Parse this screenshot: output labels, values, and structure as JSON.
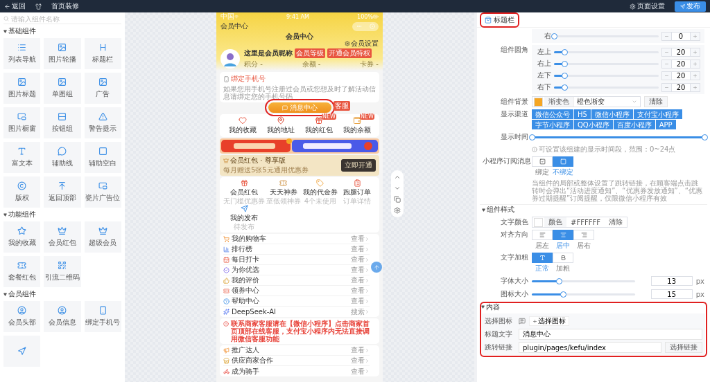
{
  "top_bar": {
    "back": "返回",
    "page_title": "首页装修",
    "page_settings": "页面设置",
    "publish": "发布"
  },
  "left_panel": {
    "search_placeholder": "请输入组件名称",
    "groups": [
      {
        "title": "基础组件",
        "expanded": true,
        "items": [
          {
            "label": "列表导航"
          },
          {
            "label": "图片轮播"
          },
          {
            "label": "标题栏"
          },
          {
            "label": "图片标题"
          },
          {
            "label": "单图组"
          },
          {
            "label": "广告"
          },
          {
            "label": "图片橱窗"
          },
          {
            "label": "按钮组"
          },
          {
            "label": "警告提示"
          },
          {
            "label": "富文本"
          },
          {
            "label": "辅助线"
          },
          {
            "label": "辅助空白"
          },
          {
            "label": "版权"
          },
          {
            "label": "返回顶部"
          },
          {
            "label": "瓷片广告位"
          }
        ]
      },
      {
        "title": "功能组件",
        "expanded": true,
        "items": [
          {
            "label": "我的收藏"
          },
          {
            "label": "会员红包"
          },
          {
            "label": "超级会员"
          },
          {
            "label": "套餐红包"
          },
          {
            "label": "引流二维码"
          }
        ]
      },
      {
        "title": "会员组件",
        "expanded": true,
        "items": [
          {
            "label": "会员头部"
          },
          {
            "label": "会员信息"
          },
          {
            "label": "绑定手机号"
          },
          {
            "label_hidden": true
          }
        ]
      }
    ]
  },
  "phone": {
    "status": {
      "carrier": "中国",
      "time": "9:41 AM",
      "battery": "100%"
    },
    "nav_label": "会员中心",
    "title": "会员中心",
    "settings": "会员设置",
    "profile": {
      "name": "这里是会员昵称",
      "tags": [
        "会员等级",
        "开通会员特权"
      ],
      "stats": [
        "积分 -",
        "余额 -",
        "卡券 -"
      ]
    },
    "bind_card": {
      "title": "绑定手机号",
      "text": "如果您用手机号注册过会员或您想及时了解活动信息请绑定您的手机号码"
    },
    "message_button": {
      "label": "消息中心",
      "highlighted": true,
      "badge": "客服"
    },
    "grid_one": [
      {
        "label": "我的收藏"
      },
      {
        "label": "我的地址"
      },
      {
        "label": "我的红包",
        "badge": "NEW"
      },
      {
        "label": "我的余额",
        "badge": "NEW"
      }
    ],
    "vip_card": {
      "title": "会员红包 · 尊享版",
      "text": "每月赠送5张5元通用优惠券",
      "button": "立即开通"
    },
    "grid_two": [
      {
        "label": "会员红包",
        "sub": "无门槛优惠券"
      },
      {
        "label": "天天神券",
        "sub": "至低领神券"
      },
      {
        "label": "我的代金券",
        "sub": "4个未使用"
      },
      {
        "label": "跑腿订单",
        "sub": "订单详情"
      },
      {
        "label": "我的发布",
        "sub": "待发布"
      }
    ],
    "list_one": [
      {
        "label": "我的购物车",
        "action": "查看"
      },
      {
        "label": "排行榜",
        "action": "查看"
      },
      {
        "label": "每日打卡",
        "action": "查看"
      },
      {
        "label": "为你优选",
        "action": "查看"
      },
      {
        "label": "我的评价",
        "action": "查看"
      },
      {
        "label": "领券中心",
        "action": "查看"
      },
      {
        "label": "帮助中心",
        "action": "查看"
      },
      {
        "label": "DeepSeek-AI",
        "action": "搜索"
      }
    ],
    "notice": "联系商家客服请在【微信小程序】点击商家首页顶部在线客服，支付宝小程序内无法直接调用微信客服功能",
    "list_two": [
      {
        "label": "推广达人",
        "action": "查看"
      },
      {
        "label": "供应商家合作",
        "action": "查看"
      },
      {
        "label": "成为骑手",
        "action": "查看"
      }
    ]
  },
  "settings": {
    "header": {
      "title": "标题栏",
      "highlighted": true
    },
    "padding_rows": [
      {
        "label": "右",
        "level": 0,
        "value": "0"
      }
    ],
    "radius": {
      "label": "组件圆角",
      "rows": [
        {
          "label": "左上",
          "level": 0.1,
          "value": "20"
        },
        {
          "label": "右上",
          "level": 0.1,
          "value": "20"
        },
        {
          "label": "左下",
          "level": 0.1,
          "value": "20"
        },
        {
          "label": "右下",
          "level": 0.1,
          "value": "20"
        }
      ]
    },
    "background": {
      "label": "组件背景",
      "color": "#f5a623",
      "mode": "渐变色",
      "value": "橙色渐变",
      "clear": "清除"
    },
    "channels": {
      "label": "显示渠道",
      "items": [
        {
          "label": "微信公众号",
          "selected": true
        },
        {
          "label": "H5",
          "selected": true
        },
        {
          "label": "微信小程序",
          "selected": true
        },
        {
          "label": "支付宝小程序",
          "selected": true
        },
        {
          "label": "字节小程序",
          "selected": true
        },
        {
          "label": "QQ小程序",
          "selected": true
        },
        {
          "label": "百度小程序",
          "selected": true
        },
        {
          "label": "APP",
          "selected": true
        }
      ]
    },
    "display_time": {
      "label": "显示时间",
      "level": 1,
      "hint": "可设置该组建的显示时间段，范围：0~24点"
    },
    "subscribe": {
      "label": "小程序订阅消息",
      "options": [
        {
          "label": "绑定",
          "selected": false
        },
        {
          "label": "不绑定",
          "selected": true
        }
      ],
      "note": "当组件的局部或整体设置了跳转链接，在顾客端点击跳转时会弹出“活动进度通知”、“优惠券发放通知”、“优惠券过期提醒”订阅提醒，仅限微信小程序有效"
    },
    "style": {
      "title": "组件样式",
      "expanded": true,
      "text_color": {
        "label": "文字颜色",
        "color": "#ffffff",
        "mode": "颜色",
        "value": "#FFFFFF",
        "clear": "清除"
      },
      "align": {
        "label": "对齐方向",
        "options": [
          {
            "label": "居左",
            "selected": false
          },
          {
            "label": "居中",
            "selected": true
          },
          {
            "label": "居右",
            "selected": false
          }
        ]
      },
      "weight": {
        "label": "文字加粗",
        "options": [
          {
            "label": "正常",
            "selected": true
          },
          {
            "label": "加粗",
            "selected": false
          }
        ]
      },
      "sizes": [
        {
          "label": "字体大小",
          "level": 0.26,
          "value": "13",
          "unit": "px"
        },
        {
          "label": "图标大小",
          "level": 0.3,
          "value": "15",
          "unit": "px"
        }
      ]
    },
    "content": {
      "title": "内容",
      "expanded": true,
      "highlighted": true,
      "icon_label": "选择图标",
      "icon_button": "选择图标",
      "title_label": "标题文字",
      "title_value": "消息中心",
      "link_label": "跳转链接",
      "link_value": "plugin/pages/kefu/index",
      "link_button": "选择链接"
    }
  }
}
